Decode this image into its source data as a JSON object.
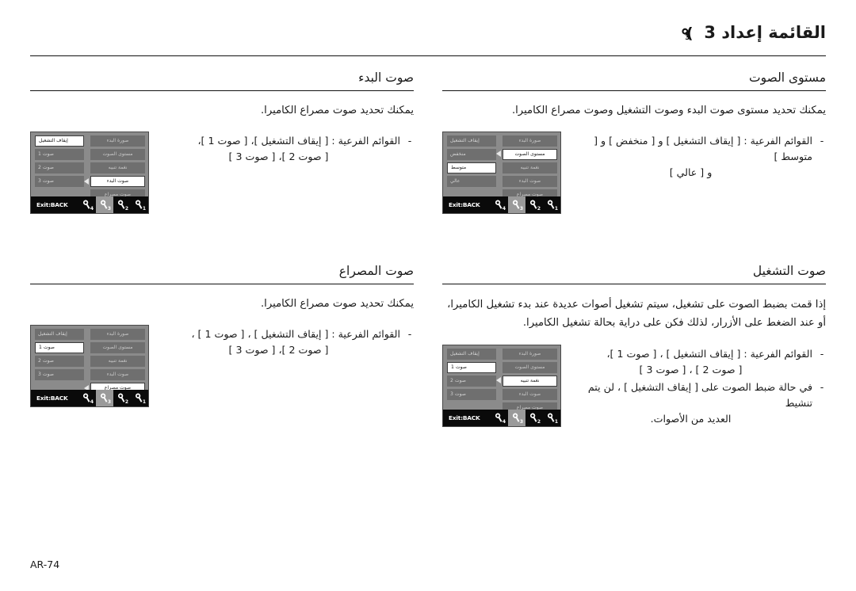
{
  "page": {
    "header_title": "القائمة إعداد 3",
    "header_badge_icon": "wrench-3-icon",
    "footer_page_number": "AR-74"
  },
  "lcd_common": {
    "menu_items": [
      "صورة البدء",
      "مستوى الصوت",
      "نغمة تنبيه",
      "صوت البدء",
      "صوت مصراع"
    ],
    "exit_label": "Exit:BACK",
    "tabs": [
      {
        "name": "wrench-1-icon",
        "subscript": "1",
        "active": false
      },
      {
        "name": "wrench-2-icon",
        "subscript": "2",
        "active": false
      },
      {
        "name": "wrench-3-icon",
        "subscript": "3",
        "active": true
      },
      {
        "name": "wrench-4-icon",
        "subscript": "4",
        "active": false
      }
    ],
    "arrow_icon": "caret-left-icon"
  },
  "sections": {
    "volume": {
      "title": "مستوى الصوت",
      "intro": "يمكنك تحديد مستوى صوت البدء وصوت التشغيل وصوت مصراع الكاميرا.",
      "bullets": [
        {
          "dash": "-",
          "lines": [
            "القوائم الفرعية : [ إيقاف التشغيل ] و [ منخفض ] و [ متوسط ]",
            "و [ عالي ]"
          ]
        }
      ],
      "lcd": {
        "selected_menu_index": 1,
        "sub_items": [
          "إيقاف التشغيل",
          "منخفض",
          "متوسط",
          "عالي",
          ""
        ],
        "selected_sub_index": 2,
        "arrow_row": 1
      }
    },
    "start_sound": {
      "title": "صوت البدء",
      "intro": "يمكنك تحديد صوت مصراع الكاميرا.",
      "bullets": [
        {
          "dash": "-",
          "lines": [
            "القوائم الفرعية : [ إيقاف التشغيل ]، [ صوت 1 ]،",
            "[ صوت 2 ]، [ صوت 3 ]"
          ]
        }
      ],
      "lcd": {
        "selected_menu_index": 3,
        "sub_items": [
          "إيقاف التشغيل",
          "صوت 1",
          "صوت 2",
          "صوت 3",
          ""
        ],
        "selected_sub_index": 0,
        "arrow_row": 3
      }
    },
    "operation_sound": {
      "title": "صوت التشغيل",
      "intro": "إذا قمت بضبط الصوت على تشغيل، سيتم تشغيل أصوات عديدة عند بدء تشغيل الكاميرا، أو عند الضغط على الأزرار، لذلك فكن على دراية بحالة تشغيل الكاميرا.",
      "bullets": [
        {
          "dash": "-",
          "lines": [
            "القوائم الفرعية : [ إيقاف التشغيل ] ، [ صوت 1 ]،",
            "[ صوت 2 ] ، [ صوت 3 ]"
          ]
        },
        {
          "dash": "-",
          "lines": [
            "في حالة ضبط الصوت على [ إيقاف التشغيل ] ، لن يتم تنشيط",
            "العديد من الأصوات."
          ]
        }
      ],
      "lcd": {
        "selected_menu_index": 2,
        "sub_items": [
          "إيقاف التشغيل",
          "صوت 1",
          "صوت 2",
          "صوت 3",
          ""
        ],
        "selected_sub_index": 1,
        "arrow_row": 2
      }
    },
    "shutter_sound": {
      "title": "صوت المصراع",
      "intro": "يمكنك تحديد صوت مصراع الكاميرا.",
      "bullets": [
        {
          "dash": "-",
          "lines": [
            "القوائم الفرعية : [ إيقاف التشغيل ] ، [ صوت 1 ] ،",
            "[ صوت 2 ]، [ صوت 3 ]"
          ]
        }
      ],
      "lcd": {
        "selected_menu_index": 4,
        "sub_items": [
          "إيقاف التشغيل",
          "صوت 1",
          "صوت 2",
          "صوت 3",
          ""
        ],
        "selected_sub_index": 1,
        "arrow_row": 4
      }
    }
  },
  "colors": {
    "page_bg": "#ffffff",
    "text": "#1a1a1a",
    "lcd_bg": "#8b8b8b",
    "lcd_pill": "#6f6f6f",
    "lcd_selected": "#ffffff",
    "lcd_bottom_bar": "#0a0a0a",
    "lcd_tab_active": "#9a9a9a"
  }
}
